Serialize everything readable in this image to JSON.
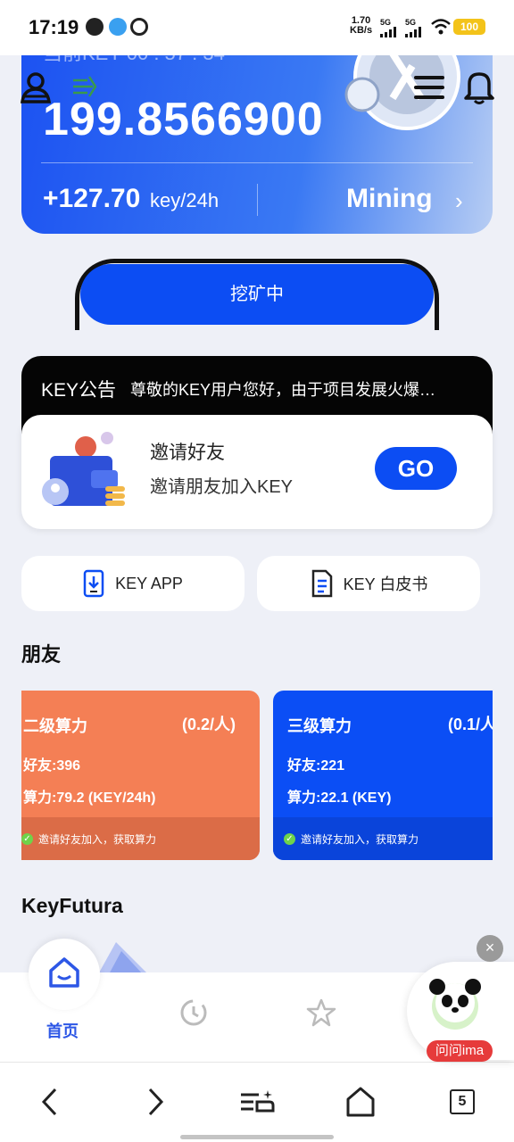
{
  "status_bar": {
    "time": "17:19",
    "net_speed_value": "1.70",
    "net_speed_unit": "KB/s",
    "signal_1": "5G",
    "signal_2": "5G",
    "battery": "100"
  },
  "balance_card": {
    "header_partial": "当前KEY  00 : 57 : 34",
    "balance": "199.8566900",
    "rate_value": "+127.70",
    "rate_unit": "key/24h",
    "mining_label": "Mining",
    "mining_arrow": "›"
  },
  "mining_button": {
    "label": "挖矿中"
  },
  "announcement": {
    "title": "KEY公告",
    "text": "尊敬的KEY用户您好，由于项目发展火爆…"
  },
  "invite": {
    "title": "邀请好友",
    "subtitle": "邀请朋友加入KEY",
    "go_label": "GO"
  },
  "quick_links": [
    {
      "label": "KEY APP",
      "icon": "phone-download-icon"
    },
    {
      "label": "KEY 白皮书",
      "icon": "document-icon"
    }
  ],
  "friends": {
    "heading": "朋友",
    "cards": [
      {
        "title": "二级算力",
        "rate": "(0.2/人)",
        "friends_line": "好友:396",
        "power_line": "算力:79.2 (KEY/24h)",
        "footer": "邀请好友加入，获取算力",
        "color": "#f47f55",
        "footer_color": "#db6c47"
      },
      {
        "title": "三级算力",
        "rate": "(0.1/人",
        "friends_line": "好友:221",
        "power_line": "算力:22.1 (KEY)",
        "footer": "邀请好友加入，获取算力",
        "color": "#0b4ef5",
        "footer_color": "#0a44da"
      }
    ]
  },
  "keyfutura": {
    "heading": "KeyFutura"
  },
  "tabbar": {
    "home_label": "首页",
    "icons": [
      "home-icon",
      "refresh-icon",
      "star-icon"
    ]
  },
  "ima": {
    "label": "问问ima",
    "close": "×"
  },
  "browser_nav": {
    "tab_count": "5"
  },
  "colors": {
    "accent": "#0c4df3",
    "orange": "#f47f55",
    "green_check": "#6fd34a"
  }
}
